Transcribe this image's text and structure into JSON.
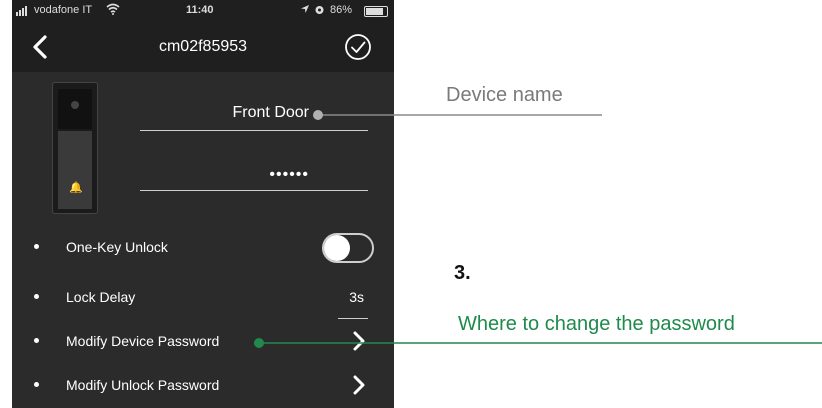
{
  "status_bar": {
    "carrier": "vodafone IT",
    "time": "11:40",
    "battery_percent": "86%",
    "battery_level": 0.86
  },
  "nav_bar": {
    "title": "cm02f85953",
    "back_icon": "chevron-left-icon",
    "confirm_icon": "check-circle-icon"
  },
  "device": {
    "name": "Front Door",
    "password_masked": "••••••"
  },
  "settings": [
    {
      "label": "One-Key Unlock",
      "control": "toggle",
      "toggle_on": false
    },
    {
      "label": "Lock Delay",
      "control": "value",
      "value": "3s"
    },
    {
      "label": "Modify Device Password",
      "control": "chevron"
    },
    {
      "label": "Modify Unlock Password",
      "control": "chevron"
    }
  ],
  "annotations": {
    "device_name": "Device name",
    "step": "3.",
    "password_hint": "Where to change the password",
    "colors": {
      "device_name": "#9a9a9a",
      "password": "#1f8a4c"
    }
  }
}
